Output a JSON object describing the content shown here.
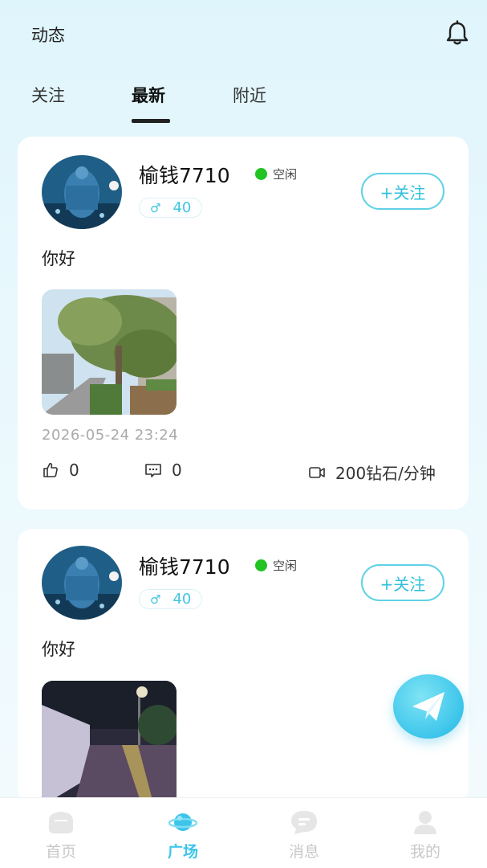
{
  "header": {
    "title": "动态",
    "bell_icon": "bell-icon"
  },
  "tabs": [
    {
      "label": "关注"
    },
    {
      "label": "最新",
      "active": true
    },
    {
      "label": "附近"
    }
  ],
  "posts": [
    {
      "username": "榆钱7710",
      "status": "空闲",
      "gender_icon": "male-icon",
      "age": "40",
      "follow_label": "+关注",
      "text": "你好",
      "time": "2026-05-24 23:24",
      "likes": "0",
      "comments": "0",
      "price": "200钻石/分钟"
    },
    {
      "username": "榆钱7710",
      "status": "空闲",
      "gender_icon": "male-icon",
      "age": "40",
      "follow_label": "+关注",
      "text": "你好"
    }
  ],
  "fab": {
    "icon": "paper-plane-icon"
  },
  "bottom_nav": [
    {
      "label": "首页",
      "icon": "home-icon"
    },
    {
      "label": "广场",
      "icon": "planet-icon",
      "active": true
    },
    {
      "label": "消息",
      "icon": "message-icon"
    },
    {
      "label": "我的",
      "icon": "person-icon"
    }
  ],
  "colors": {
    "accent": "#3cc5ea",
    "status_online": "#22c322"
  }
}
